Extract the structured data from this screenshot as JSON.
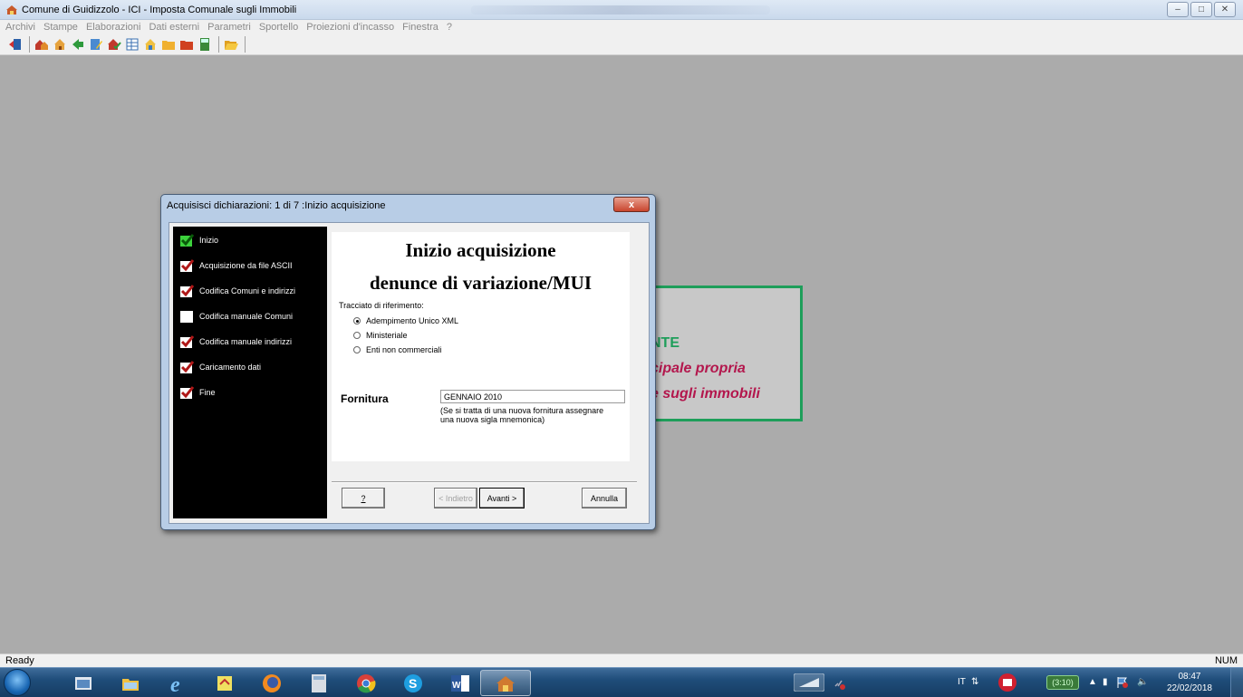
{
  "window": {
    "title": "Comune di Guidizzolo - ICI - Imposta Comunale sugli Immobili",
    "icon": "municipality-icon"
  },
  "menu": [
    "Archivi",
    "Stampe",
    "Elaborazioni",
    "Dati esterni",
    "Parametri",
    "Sportello",
    "Proiezioni d'incasso",
    "Finestra",
    "?"
  ],
  "toolbar_icons": [
    "exit-icon",
    "houses-icon",
    "home-icon",
    "arrow-icon",
    "edit-icon",
    "house-check-icon",
    "grid-icon",
    "home2-icon",
    "folder-icon",
    "folder-red-icon",
    "calculator-icon",
    "folder-open-icon"
  ],
  "splash": {
    "line1": "NTE",
    "line2": "cipale propria",
    "line3": "e sugli immobili"
  },
  "dialog": {
    "title": "Acquisisci dichiarazioni: 1 di 7 :Inizio acquisizione",
    "close_label": "x",
    "steps": [
      {
        "label": "Inizio",
        "state": "current"
      },
      {
        "label": "Acquisizione da file ASCII",
        "state": "checked"
      },
      {
        "label": "Codifica Comuni e indirizzi",
        "state": "checked"
      },
      {
        "label": "Codifica manuale Comuni",
        "state": "blank"
      },
      {
        "label": "Codifica manuale indirizzi",
        "state": "checked"
      },
      {
        "label": "Caricamento dati",
        "state": "checked"
      },
      {
        "label": "Fine",
        "state": "checked"
      }
    ],
    "heading1": "Inizio acquisizione",
    "heading2": "denunce di variazione/MUI",
    "tracciato_label": "Tracciato di riferimento:",
    "radios": [
      {
        "label": "Adempimento Unico XML",
        "selected": true
      },
      {
        "label": "Ministeriale",
        "selected": false
      },
      {
        "label": "Enti non commerciali",
        "selected": false
      }
    ],
    "fornitura_label": "Fornitura",
    "fornitura_value": "GENNAIO 2010",
    "fornitura_note_1": "(Se si tratta di una nuova fornitura assegnare",
    "fornitura_note_2": "una nuova sigla mnemonica)",
    "buttons": {
      "help": "?",
      "back": "< Indietro",
      "next": "Avanti >",
      "cancel": "Annulla"
    }
  },
  "status": {
    "left": "Ready",
    "right": "NUM"
  },
  "taskbar": {
    "apps": [
      "start-orb",
      "app-icon",
      "file-explorer-icon",
      "internet-explorer-icon",
      "app-icon-2",
      "firefox-icon",
      "calculator-icon",
      "chrome-icon",
      "skype-icon",
      "word-icon",
      "ici-app-icon"
    ],
    "language": "IT",
    "battery": "(3:10)",
    "time": "08:47",
    "date": "22/02/2018"
  }
}
